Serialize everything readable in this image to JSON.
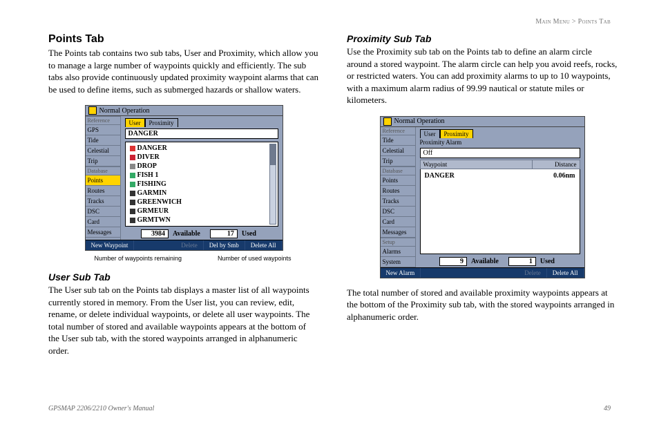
{
  "breadcrumb": {
    "path": "Main Menu > ",
    "current": "Points Tab"
  },
  "left": {
    "h1": "Points Tab",
    "p1": "The Points tab contains two sub tabs, User and Proximity, which allow you to manage a large number of waypoints quickly and efficiently. The sub tabs also provide continuously updated proximity waypoint alarms that can be used to define items, such as submerged hazards or shallow waters.",
    "shot": {
      "title": "Normal Operation",
      "navGroups": [
        "Reference",
        "Database"
      ],
      "nav": {
        "reference": [
          "GPS",
          "Tide",
          "Celestial",
          "Trip"
        ],
        "database": [
          "Points",
          "Routes",
          "Tracks",
          "DSC",
          "Card",
          "Messages"
        ]
      },
      "selectedNav": "Points",
      "tabs": [
        "User",
        "Proximity"
      ],
      "selectedTab": "User",
      "field": "DANGER",
      "list": [
        {
          "icon": "skull",
          "label": "DANGER"
        },
        {
          "icon": "diver",
          "label": "DIVER"
        },
        {
          "icon": "box",
          "label": "DROP"
        },
        {
          "icon": "fish",
          "label": "FISH 1"
        },
        {
          "icon": "fish",
          "label": "FISHING"
        },
        {
          "icon": "dot",
          "label": "GARMIN"
        },
        {
          "icon": "dot",
          "label": "GREENWICH"
        },
        {
          "icon": "dot",
          "label": "GRMEUR"
        },
        {
          "icon": "dot",
          "label": "GRMTWN"
        }
      ],
      "available": "3984",
      "availableLabel": "Available",
      "used": "17",
      "usedLabel": "Used",
      "buttons": {
        "new": "New Waypoint",
        "delete": "Delete",
        "delBySmb": "Del by Smb",
        "deleteAll": "Delete All"
      }
    },
    "captionLeft": "Number of waypoints remaining",
    "captionRight": "Number of used waypoints",
    "h2": "User Sub Tab",
    "p2": "The User sub tab on the Points tab displays a master list of all waypoints currently stored in memory. From the User list, you can review, edit, rename, or delete individual waypoints, or delete all user waypoints. The total number of stored and available waypoints appears at the bottom of the User sub tab, with the stored waypoints arranged in alphanumeric order."
  },
  "right": {
    "h2": "Proximity Sub Tab",
    "p1": "Use the Proximity sub tab on the Points tab to define an alarm circle around a stored waypoint. The alarm circle can help you avoid reefs, rocks, or restricted waters. You can add proximity alarms to up to 10 waypoints, with a maximum alarm radius of 99.99 nautical or statute miles or kilometers.",
    "shot": {
      "title": "Normal Operation",
      "navGroups": [
        "Reference",
        "Database",
        "Setup"
      ],
      "nav": {
        "reference": [
          "Tide",
          "Celestial",
          "Trip"
        ],
        "database": [
          "Points",
          "Routes",
          "Tracks",
          "DSC",
          "Card",
          "Messages"
        ],
        "setup": [
          "Alarms",
          "System"
        ]
      },
      "selectedNav": "Points",
      "tabs": [
        "User",
        "Proximity"
      ],
      "selectedTab": "Proximity",
      "alarmLabel": "Proximity Alarm",
      "alarmValue": "Off",
      "headers": {
        "waypoint": "Waypoint",
        "distance": "Distance"
      },
      "rows": [
        {
          "name": "DANGER",
          "dist": "0.06nm"
        }
      ],
      "available": "9",
      "availableLabel": "Available",
      "used": "1",
      "usedLabel": "Used",
      "buttons": {
        "new": "New Alarm",
        "delete": "Delete",
        "deleteAll": "Delete All"
      }
    },
    "p2": "The total number of stored and available proximity waypoints appears at the bottom of the Proximity sub tab, with the stored waypoints arranged in alphanumeric order."
  },
  "footer": {
    "left": "GPSMAP 2206/2210 Owner's Manual",
    "right": "49"
  }
}
